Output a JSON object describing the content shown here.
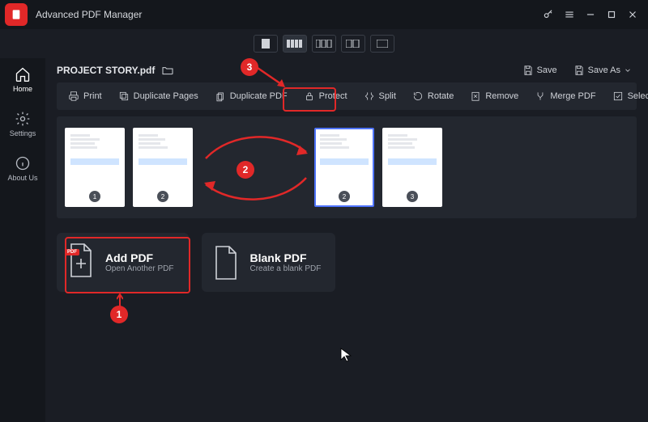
{
  "titlebar": {
    "app_title": "Advanced PDF Manager"
  },
  "sidebar": {
    "items": [
      {
        "label": "Home"
      },
      {
        "label": "Settings"
      },
      {
        "label": "About Us"
      }
    ]
  },
  "document": {
    "filename": "PROJECT STORY.pdf"
  },
  "header_actions": {
    "save": "Save",
    "save_as": "Save As"
  },
  "toolbar": {
    "print": "Print",
    "duplicate_pages": "Duplicate Pages",
    "duplicate_pdf": "Duplicate PDF",
    "protect": "Protect",
    "split": "Split",
    "rotate": "Rotate",
    "remove": "Remove",
    "merge_pdf": "Merge PDF",
    "select_all": "Select All"
  },
  "thumbs": [
    {
      "page": "1"
    },
    {
      "page": "2"
    },
    {
      "page": "2"
    },
    {
      "page": "3"
    }
  ],
  "cards": {
    "add_pdf": {
      "title": "Add PDF",
      "subtitle": "Open Another PDF",
      "badge": "PDF"
    },
    "blank_pdf": {
      "title": "Blank PDF",
      "subtitle": "Create a blank PDF"
    }
  },
  "annotations": {
    "n1": "1",
    "n2": "2",
    "n3": "3"
  }
}
